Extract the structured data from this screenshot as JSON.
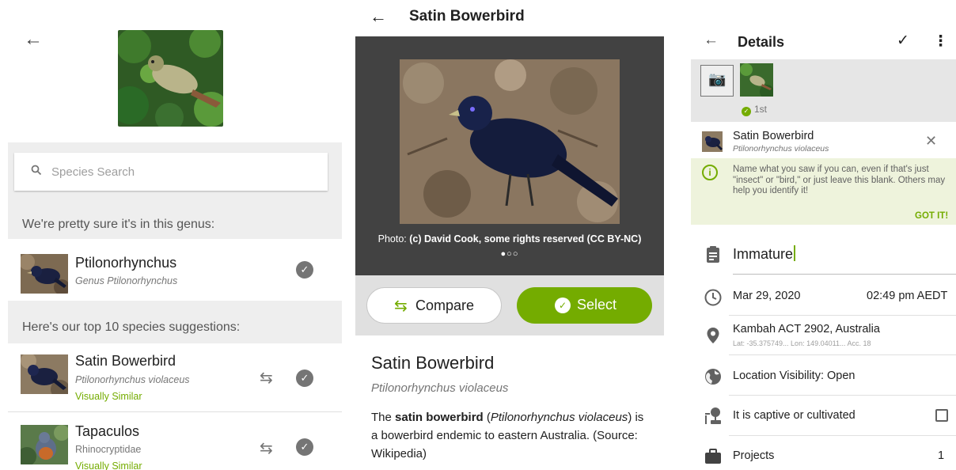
{
  "identify": {
    "search_placeholder": "Species Search",
    "genus_header": "We're pretty sure it's in this genus:",
    "genus": {
      "name": "Ptilonorhynchus",
      "sub": "Genus Ptilonorhynchus"
    },
    "top_header": "Here's our top 10 species suggestions:",
    "suggestions": [
      {
        "name": "Satin Bowerbird",
        "sub": "Ptilonorhynchus violaceus",
        "tag": "Visually Similar"
      },
      {
        "name": "Tapaculos",
        "sub": "Rhinocryptidae",
        "tag": "Visually Similar"
      }
    ]
  },
  "species": {
    "title": "Satin Bowerbird",
    "photo_credit_prefix": "Photo: ",
    "photo_credit": "(c) David Cook, some rights reserved (CC BY-NC)",
    "pager_dots": "●○○",
    "compare_label": "Compare",
    "select_label": "Select",
    "common_name": "Satin Bowerbird",
    "scientific_name": "Ptilonorhynchus violaceus",
    "desc_pre": "The ",
    "desc_bold": "satin bowerbird",
    "desc_open": " (",
    "desc_italic": "Ptilonorhynchus violaceus",
    "desc_rest": ") is a bowerbird endemic to eastern Australia. (Source: Wikipedia)"
  },
  "details": {
    "title": "Details",
    "photo_badge": "1st",
    "taxon_name": "Satin Bowerbird",
    "taxon_sci": "Ptilonorhynchus violaceus",
    "tip_text": "Name what you saw if you can, even if that's just \"insect\" or \"bird,\" or just leave this blank. Others may help you identify it!",
    "tip_dismiss": "GOT IT!",
    "notes": "Immature",
    "date": "Mar 29, 2020",
    "time": "02:49 pm AEDT",
    "location": "Kambah ACT 2902, Australia",
    "coords": "Lat: -35.375749...  Lon: 149.04011...  Acc. 18",
    "visibility": "Location Visibility: Open",
    "captive": "It is captive or cultivated",
    "projects": "Projects",
    "projects_count": "1"
  },
  "colors": {
    "accent": "#74ac00",
    "grey_bg": "#eeeeee",
    "dark_bg": "#424242"
  },
  "icons": [
    "back-arrow-icon",
    "search-icon",
    "check-circle-icon",
    "compare-icon",
    "add-photo-icon",
    "close-icon",
    "info-icon",
    "clipboard-icon",
    "clock-icon",
    "location-pin-icon",
    "globe-icon",
    "captive-icon",
    "briefcase-icon",
    "checkmark-icon",
    "more-vert-icon"
  ]
}
